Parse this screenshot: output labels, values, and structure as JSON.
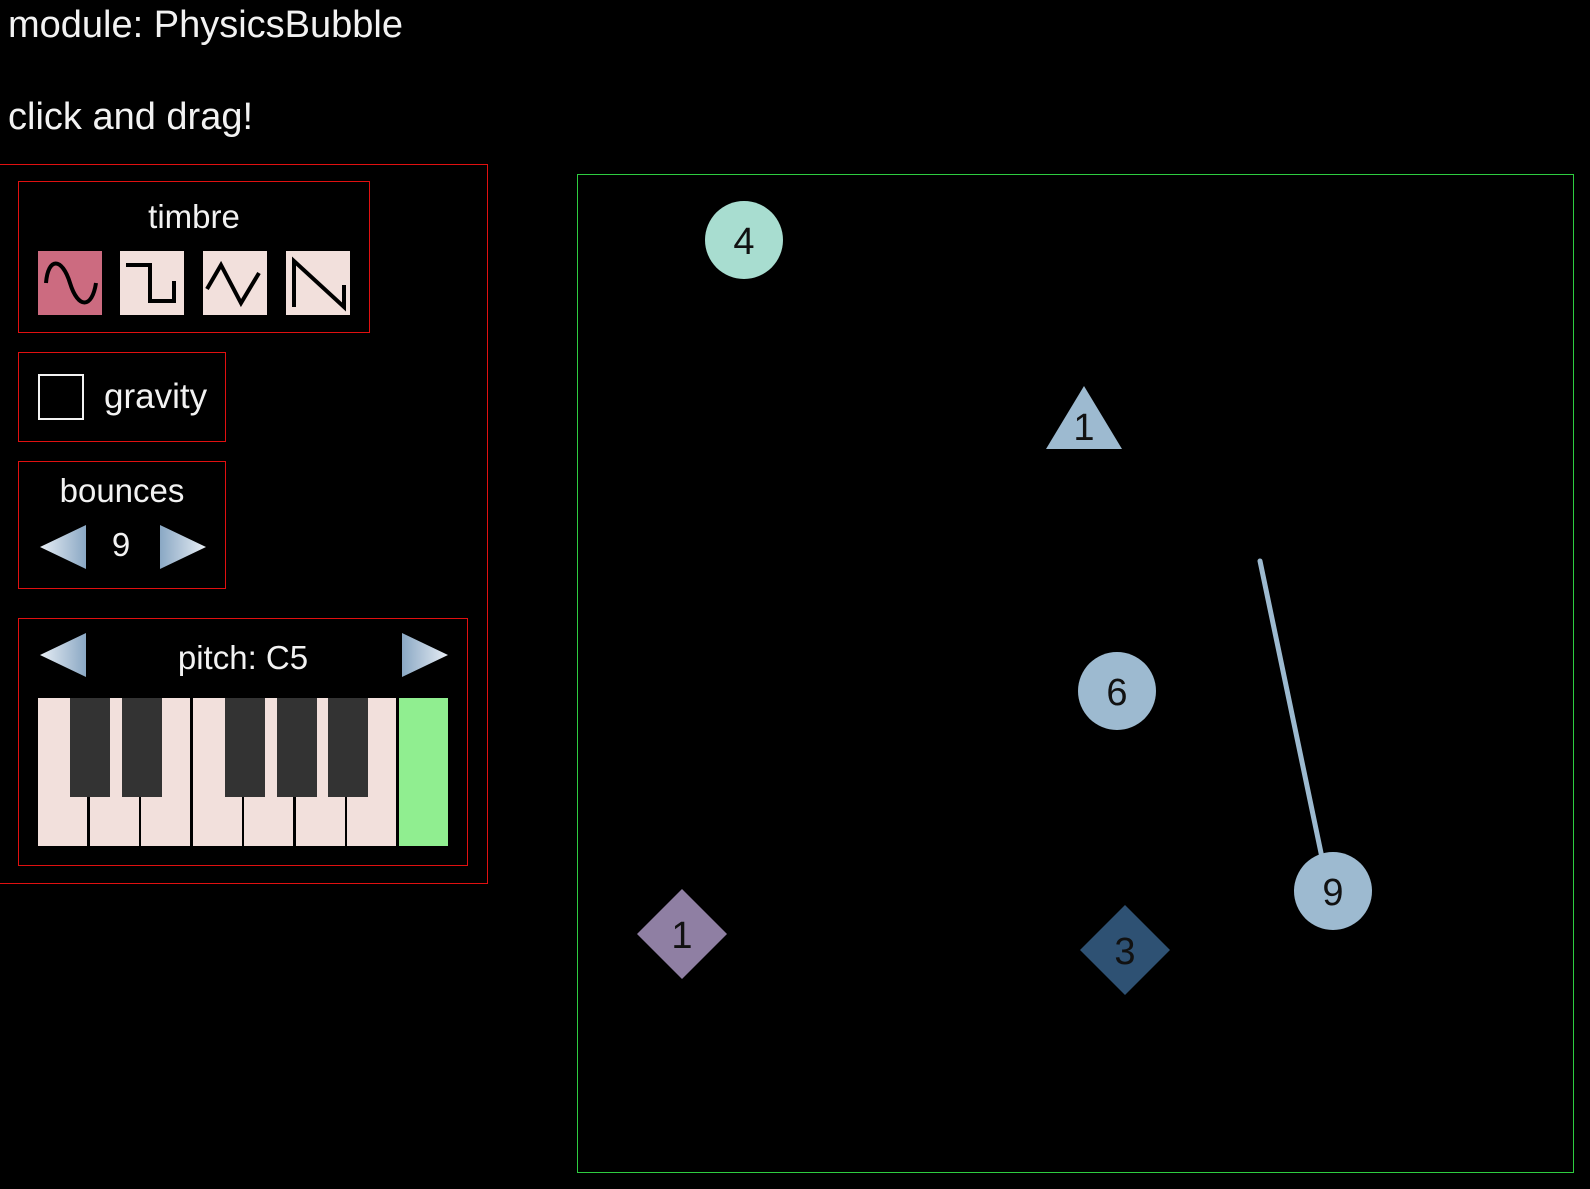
{
  "header": {
    "module_title": "module: PhysicsBubble",
    "hint": "click and drag!"
  },
  "controls": {
    "timbre": {
      "label": "timbre",
      "selected": "sine",
      "options": [
        {
          "name": "sine",
          "icon": "sine-wave-icon"
        },
        {
          "name": "square",
          "icon": "square-wave-icon"
        },
        {
          "name": "triangle",
          "icon": "triangle-wave-icon"
        },
        {
          "name": "sawtooth",
          "icon": "sawtooth-wave-icon"
        }
      ]
    },
    "gravity": {
      "label": "gravity",
      "checked": false
    },
    "bounces": {
      "label": "bounces",
      "value": "9",
      "decrement_icon": "arrow-left-icon",
      "increment_icon": "arrow-right-icon"
    },
    "pitch": {
      "label": "pitch: C5",
      "decrement_icon": "arrow-left-icon",
      "increment_icon": "arrow-right-icon",
      "white_keys": [
        "C",
        "D",
        "E",
        "F",
        "G",
        "A",
        "B",
        "C"
      ],
      "active_white_key_index": 7
    }
  },
  "arena": {
    "bubbles": [
      {
        "shape": "circle",
        "label": "4",
        "color": "#a8ddd0"
      },
      {
        "shape": "triangle",
        "label": "1",
        "color": "#9dbad0"
      },
      {
        "shape": "circle",
        "label": "6",
        "color": "#9dbad0"
      },
      {
        "shape": "circle",
        "label": "9",
        "color": "#9dbad0",
        "has_tether": true
      },
      {
        "shape": "diamond",
        "label": "1",
        "color": "#8f7fa3"
      },
      {
        "shape": "diamond",
        "label": "3",
        "color": "#2e5173"
      }
    ]
  },
  "colors": {
    "panel_border": "#e01010",
    "arena_border": "#2ecc40",
    "selected_wave": "#cc6b80",
    "button_face": "#f2e0dc",
    "active_key": "#90ee90",
    "black_key": "#333333"
  }
}
